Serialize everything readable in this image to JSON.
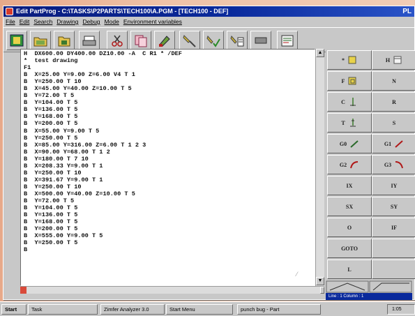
{
  "window": {
    "title": "Edit PartProg - C:\\TASKS\\P2PARTS\\TECH100\\A.PGM - [TECH100 - DEF]",
    "title_right": "PL"
  },
  "menu": [
    "File",
    "Edit",
    "Search",
    "Drawing",
    "Debug",
    "Mode",
    "Environment variables"
  ],
  "toolbar": {
    "buttons": [
      "open-punch-icon",
      "open-folder-icon",
      "save-icon",
      "print-icon",
      "cut-icon",
      "copy-icon",
      "paint-icon",
      "wrench-icon",
      "tool-check-icon",
      "tool-edit-icon",
      "stop-icon",
      "program-icon"
    ]
  },
  "editor": {
    "lines": [
      "H  DX600.00 DY400.00 DZ10.00 -A  C R1 * /DEF",
      "*  test drawing",
      "F1",
      "B  X=25.00 Y=9.00 Z=6.00 V4 T 1",
      "B  Y=250.00 T 10",
      "B  X=45.00 Y=40.00 Z=10.00 T 5",
      "B  Y=72.00 T 5",
      "B  Y=104.00 T 5",
      "B  Y=136.00 T 5",
      "B  Y=168.00 T 5",
      "B  Y=200.00 T 5",
      "B  X=55.00 Y=9.00 T 5",
      "B  Y=250.00 T 5",
      "B  X=85.00 Y=316.00 Z=6.00 T 1 2 3",
      "B  X=90.00 Y=68.00 T 1 2",
      "B  Y=180.00 T 7 10",
      "B  X=208.33 Y=9.00 T 1",
      "B  Y=250.00 T 10",
      "B  X=391.67 Y=9.00 T 1",
      "B  Y=250.00 T 10",
      "B  X=500.00 Y=40.00 Z=10.00 T 5",
      "B  Y=72.00 T 5",
      "B  Y=104.00 T 5",
      "B  Y=136.00 T 5",
      "B  Y=168.00 T 5",
      "B  Y=200.00 T 5",
      "B  X=555.00 Y=9.00 T 5",
      "B  Y=250.00 T 5",
      "B"
    ]
  },
  "keypad": {
    "rows": [
      [
        {
          "label": "*",
          "icon": "comment-icon"
        },
        {
          "label": "H",
          "icon": "header-icon"
        }
      ],
      [
        {
          "label": "F",
          "icon": "frame-icon"
        },
        {
          "label": "N",
          "icon": ""
        }
      ],
      [
        {
          "label": "C",
          "icon": "center-icon"
        },
        {
          "label": "R",
          "icon": ""
        }
      ],
      [
        {
          "label": "T",
          "icon": "tool-icon"
        },
        {
          "label": "S",
          "icon": ""
        }
      ],
      [
        {
          "label": "G0",
          "icon": "rapid-icon"
        },
        {
          "label": "G1",
          "icon": "linear-icon"
        }
      ],
      [
        {
          "label": "G2",
          "icon": "arc-icon"
        },
        {
          "label": "G3",
          "icon": "arc-ccw-icon"
        }
      ],
      [
        {
          "label": "IX",
          "icon": ""
        },
        {
          "label": "IY",
          "icon": ""
        }
      ],
      [
        {
          "label": "SX",
          "icon": ""
        },
        {
          "label": "SY",
          "icon": ""
        }
      ],
      [
        {
          "label": "O",
          "icon": ""
        },
        {
          "label": "IF",
          "icon": ""
        }
      ],
      [
        {
          "label": "GOTO",
          "icon": ""
        },
        {
          "label": "",
          "icon": ""
        }
      ],
      [
        {
          "label": "L",
          "icon": ""
        },
        {
          "label": "",
          "icon": ""
        }
      ]
    ]
  },
  "status": {
    "text": "Line : 1  Column : 1"
  },
  "taskbar": {
    "start": "Start",
    "tasks": [
      "Task",
      "Zimfer Analyzer 3.0",
      "Start Menu",
      "punch bug - Part"
    ],
    "tray": "1:05"
  },
  "colors": {
    "title_bar": "#0a1c7e",
    "window_face": "#c8c8c8",
    "desktop": "#e9b394"
  }
}
